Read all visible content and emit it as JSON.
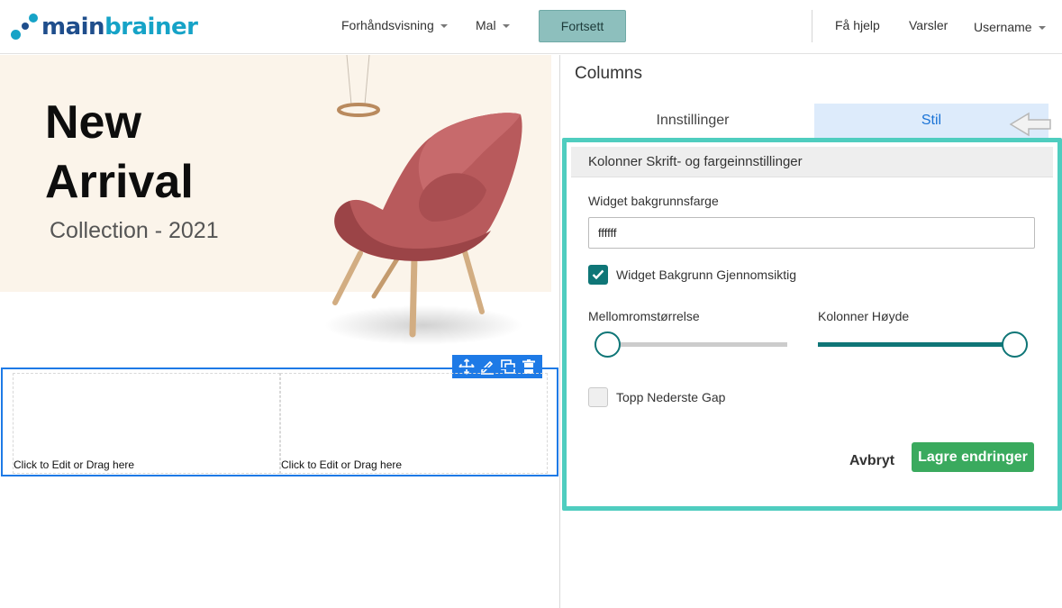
{
  "logo": {
    "part1": "main",
    "part2": "brainer"
  },
  "nav": {
    "preview_label": "Forhåndsvisning",
    "template_label": "Mal",
    "continue_label": "Fortsett",
    "help_label": "Få hjelp",
    "notifications_label": "Varsler",
    "user_label": "Username"
  },
  "banner": {
    "title_line1": "New",
    "title_line2": "Arrival",
    "subtitle": "Collection - 2021"
  },
  "columns": {
    "cell1_label": "Click to Edit or Drag here",
    "cell2_label": "Click to Edit or Drag here"
  },
  "panel": {
    "title": "Columns",
    "tab_settings": "Innstillinger",
    "tab_style": "Stil",
    "section_header": "Kolonner Skrift- og fargeinnstillinger",
    "bg_color_label": "Widget bakgrunnsfarge",
    "bg_color_value": "ffffff",
    "transparent_label": "Widget Bakgrunn Gjennomsiktig",
    "transparent_checked": true,
    "spacing_label": "Mellomromstørrelse",
    "spacing_value": 0,
    "height_label": "Kolonner Høyde",
    "height_value": 100,
    "gap_label": "Topp Nederste Gap",
    "gap_checked": false,
    "cancel_label": "Avbryt",
    "save_label": "Lagre endringer"
  },
  "colors": {
    "accent_teal": "#0f7677",
    "highlight_border": "#4fcdbf",
    "selection_blue": "#1e7ae6",
    "save_green": "#3aaa5e",
    "continue_bg": "#8dbfbd"
  }
}
